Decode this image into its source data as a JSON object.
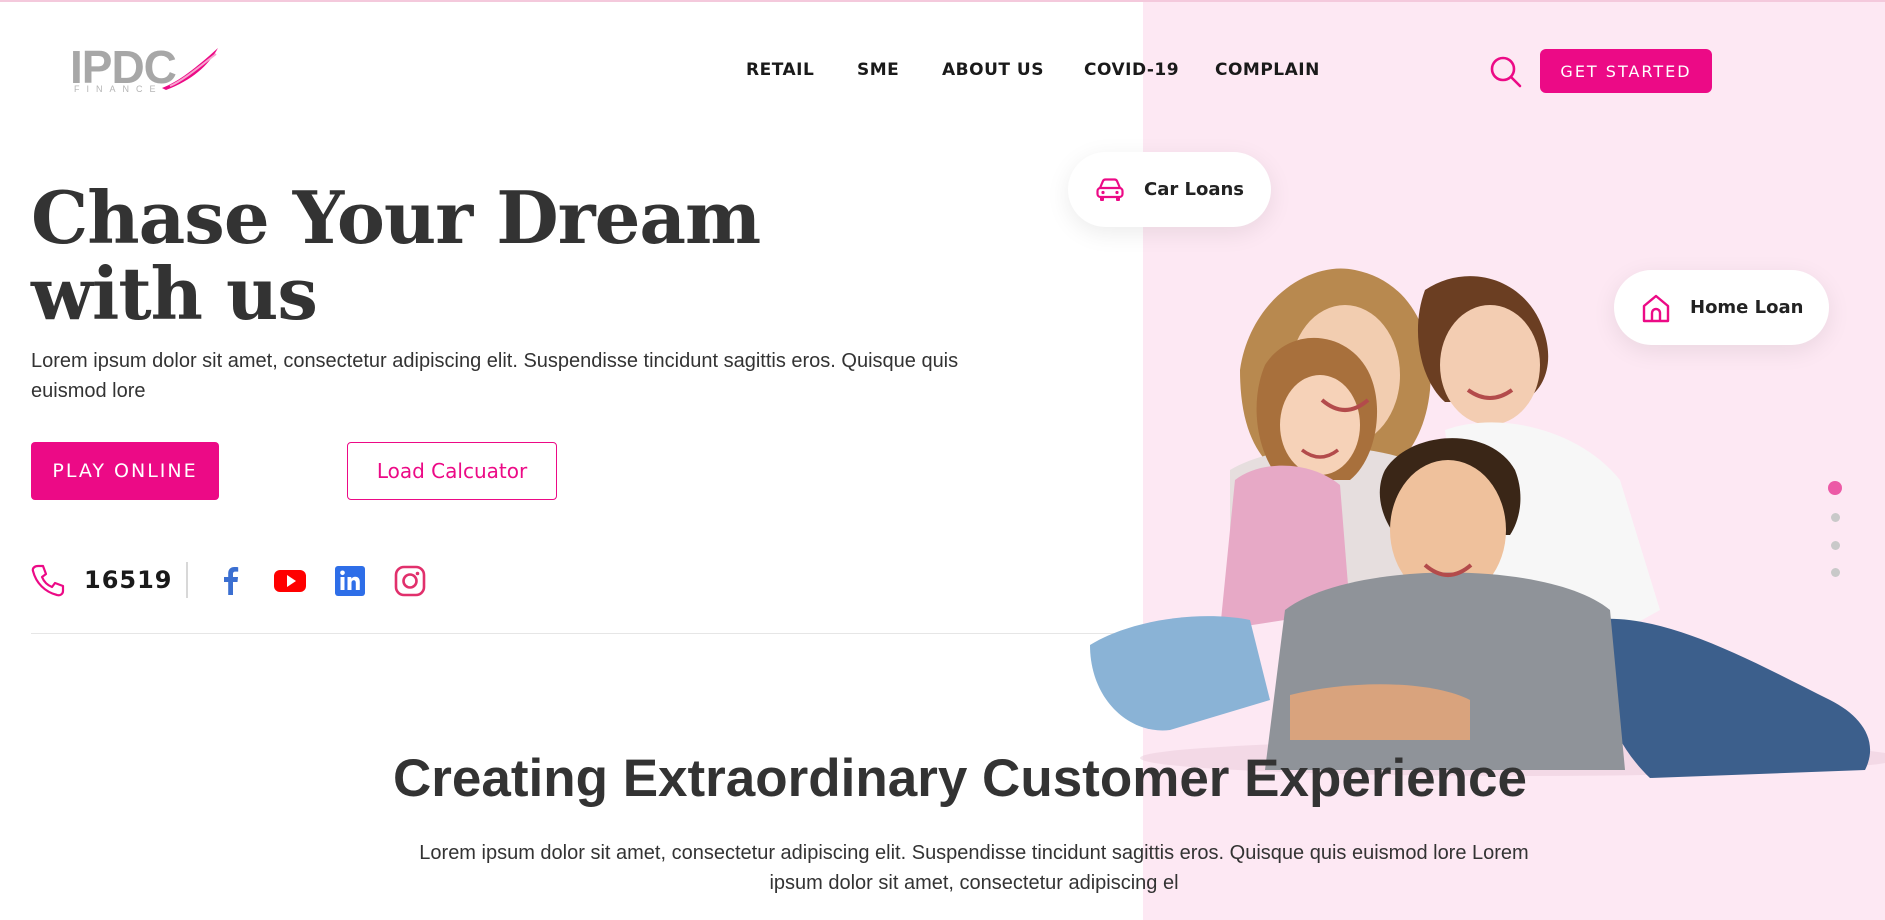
{
  "header": {
    "logo_text": "IPDC",
    "logo_sub": "FINANCE",
    "nav": [
      {
        "label": "RETAIL"
      },
      {
        "label": "SME"
      },
      {
        "label": "ABOUT US"
      },
      {
        "label": "COVID-19"
      },
      {
        "label": "COMPLAIN"
      }
    ],
    "search_icon": "search-icon",
    "cta_label": "GET STARTED"
  },
  "hero": {
    "title": "Chase Your Dream with us",
    "description": "Lorem ipsum dolor sit amet, consectetur adipiscing elit. Suspendisse tincidunt sagittis eros. Quisque quis euismod lore",
    "primary_button": "PLAY ONLINE",
    "secondary_button": "Load Calcuator",
    "phone": "16519",
    "social": [
      "facebook-icon",
      "youtube-icon",
      "linkedin-icon",
      "instagram-icon"
    ]
  },
  "badges": {
    "car": {
      "label": "Car Loans",
      "icon": "car-icon"
    },
    "home": {
      "label": "Home Loan",
      "icon": "home-icon"
    }
  },
  "carousel": {
    "slide_count": 4,
    "active_index": 0
  },
  "section": {
    "title": "Creating Extraordinary Customer Experience",
    "description": "Lorem ipsum dolor sit amet, consectetur adipiscing elit. Suspendisse tincidunt sagittis eros. Quisque quis euismod lore Lorem ipsum dolor sit amet, consectetur adipiscing el"
  },
  "colors": {
    "accent": "#ec0a86",
    "panel": "#fde8f3",
    "text": "#333333"
  }
}
